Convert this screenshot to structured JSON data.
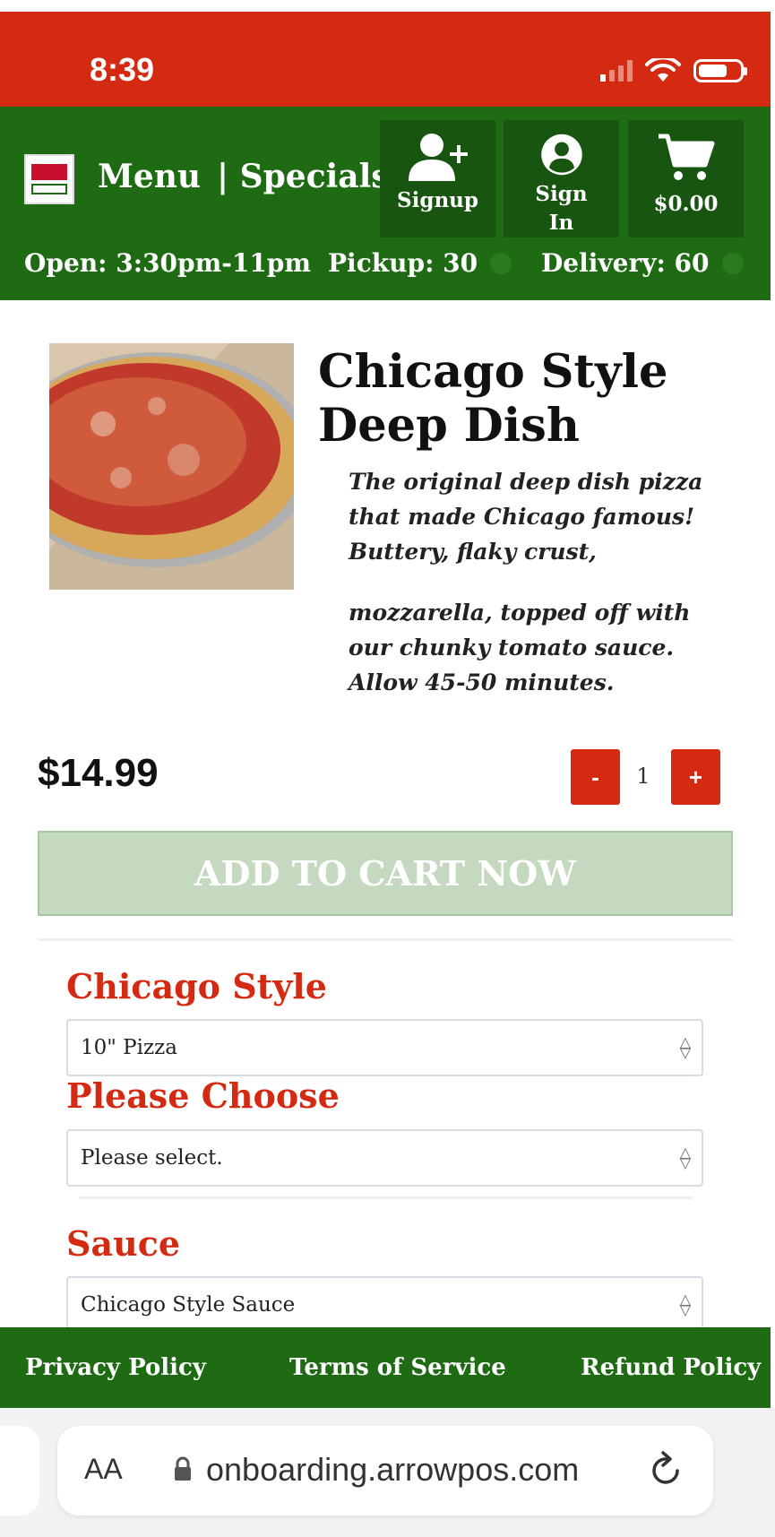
{
  "status_bar": {
    "time": "8:39"
  },
  "header": {
    "nav_menu": "Menu",
    "nav_specials": "| Specials",
    "signup_label": "Signup",
    "signin_label": "Sign In",
    "cart_total": "$0.00",
    "open_hours": "Open: 3:30pm-11pm",
    "pickup": "Pickup: 30",
    "delivery": "Delivery: 60"
  },
  "product": {
    "name": "Chicago Style Deep Dish",
    "description_1": "The original deep dish pizza that made Chicago famous! Buttery, flaky crust,",
    "description_2": "mozzarella, topped off with our chunky tomato sauce. Allow 45-50 minutes.",
    "price": "$14.99",
    "quantity": "1",
    "minus_label": "-",
    "plus_label": "+",
    "add_to_cart": "ADD TO CART NOW"
  },
  "options": {
    "chicago_style_label": "Chicago Style",
    "chicago_style_value": "10\" Pizza",
    "please_choose_label": "Please Choose",
    "please_choose_value": "Please select.",
    "sauce_label": "Sauce",
    "sauce_value": "Chicago Style Sauce"
  },
  "footer": {
    "privacy": "Privacy Policy",
    "terms": "Terms of Service",
    "refund": "Refund Policy"
  },
  "browser": {
    "text_size": "AA",
    "url": "onboarding.arrowpos.com"
  },
  "colors": {
    "status_red": "#d42a12",
    "header_green": "#1f6b14",
    "accent_red": "#d42a12",
    "button_disabled_green": "#c4d9c0"
  }
}
